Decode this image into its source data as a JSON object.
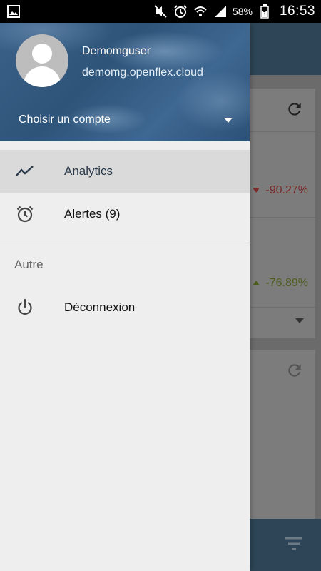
{
  "status_bar": {
    "left_icon": "gallery-icon",
    "icons": [
      "mute-icon",
      "alarm-icon",
      "wifi-icon",
      "signal-icon"
    ],
    "battery_percent": "58%",
    "time": "16:53"
  },
  "drawer": {
    "user": {
      "name": "Demomguser",
      "email": "demomg.openflex.cloud"
    },
    "account_chooser_label": "Choisir un compte",
    "items": [
      {
        "label": "Analytics",
        "icon": "trending-line-icon",
        "active": true
      },
      {
        "label": "Alertes (9)",
        "icon": "alarm-clock-icon",
        "active": false
      }
    ],
    "section_title": "Autre",
    "other_items": [
      {
        "label": "Déconnexion",
        "icon": "power-icon"
      }
    ]
  },
  "background": {
    "values": [
      {
        "text": "-90.27%",
        "trend": "down",
        "color": "#c0392b"
      },
      {
        "text": "-76.89%",
        "trend": "up",
        "color": "#7a9a2a"
      }
    ],
    "colors": {
      "toolbar": "#2d4556",
      "accent_red": "#c0392b",
      "accent_green": "#7a9a2a"
    }
  }
}
